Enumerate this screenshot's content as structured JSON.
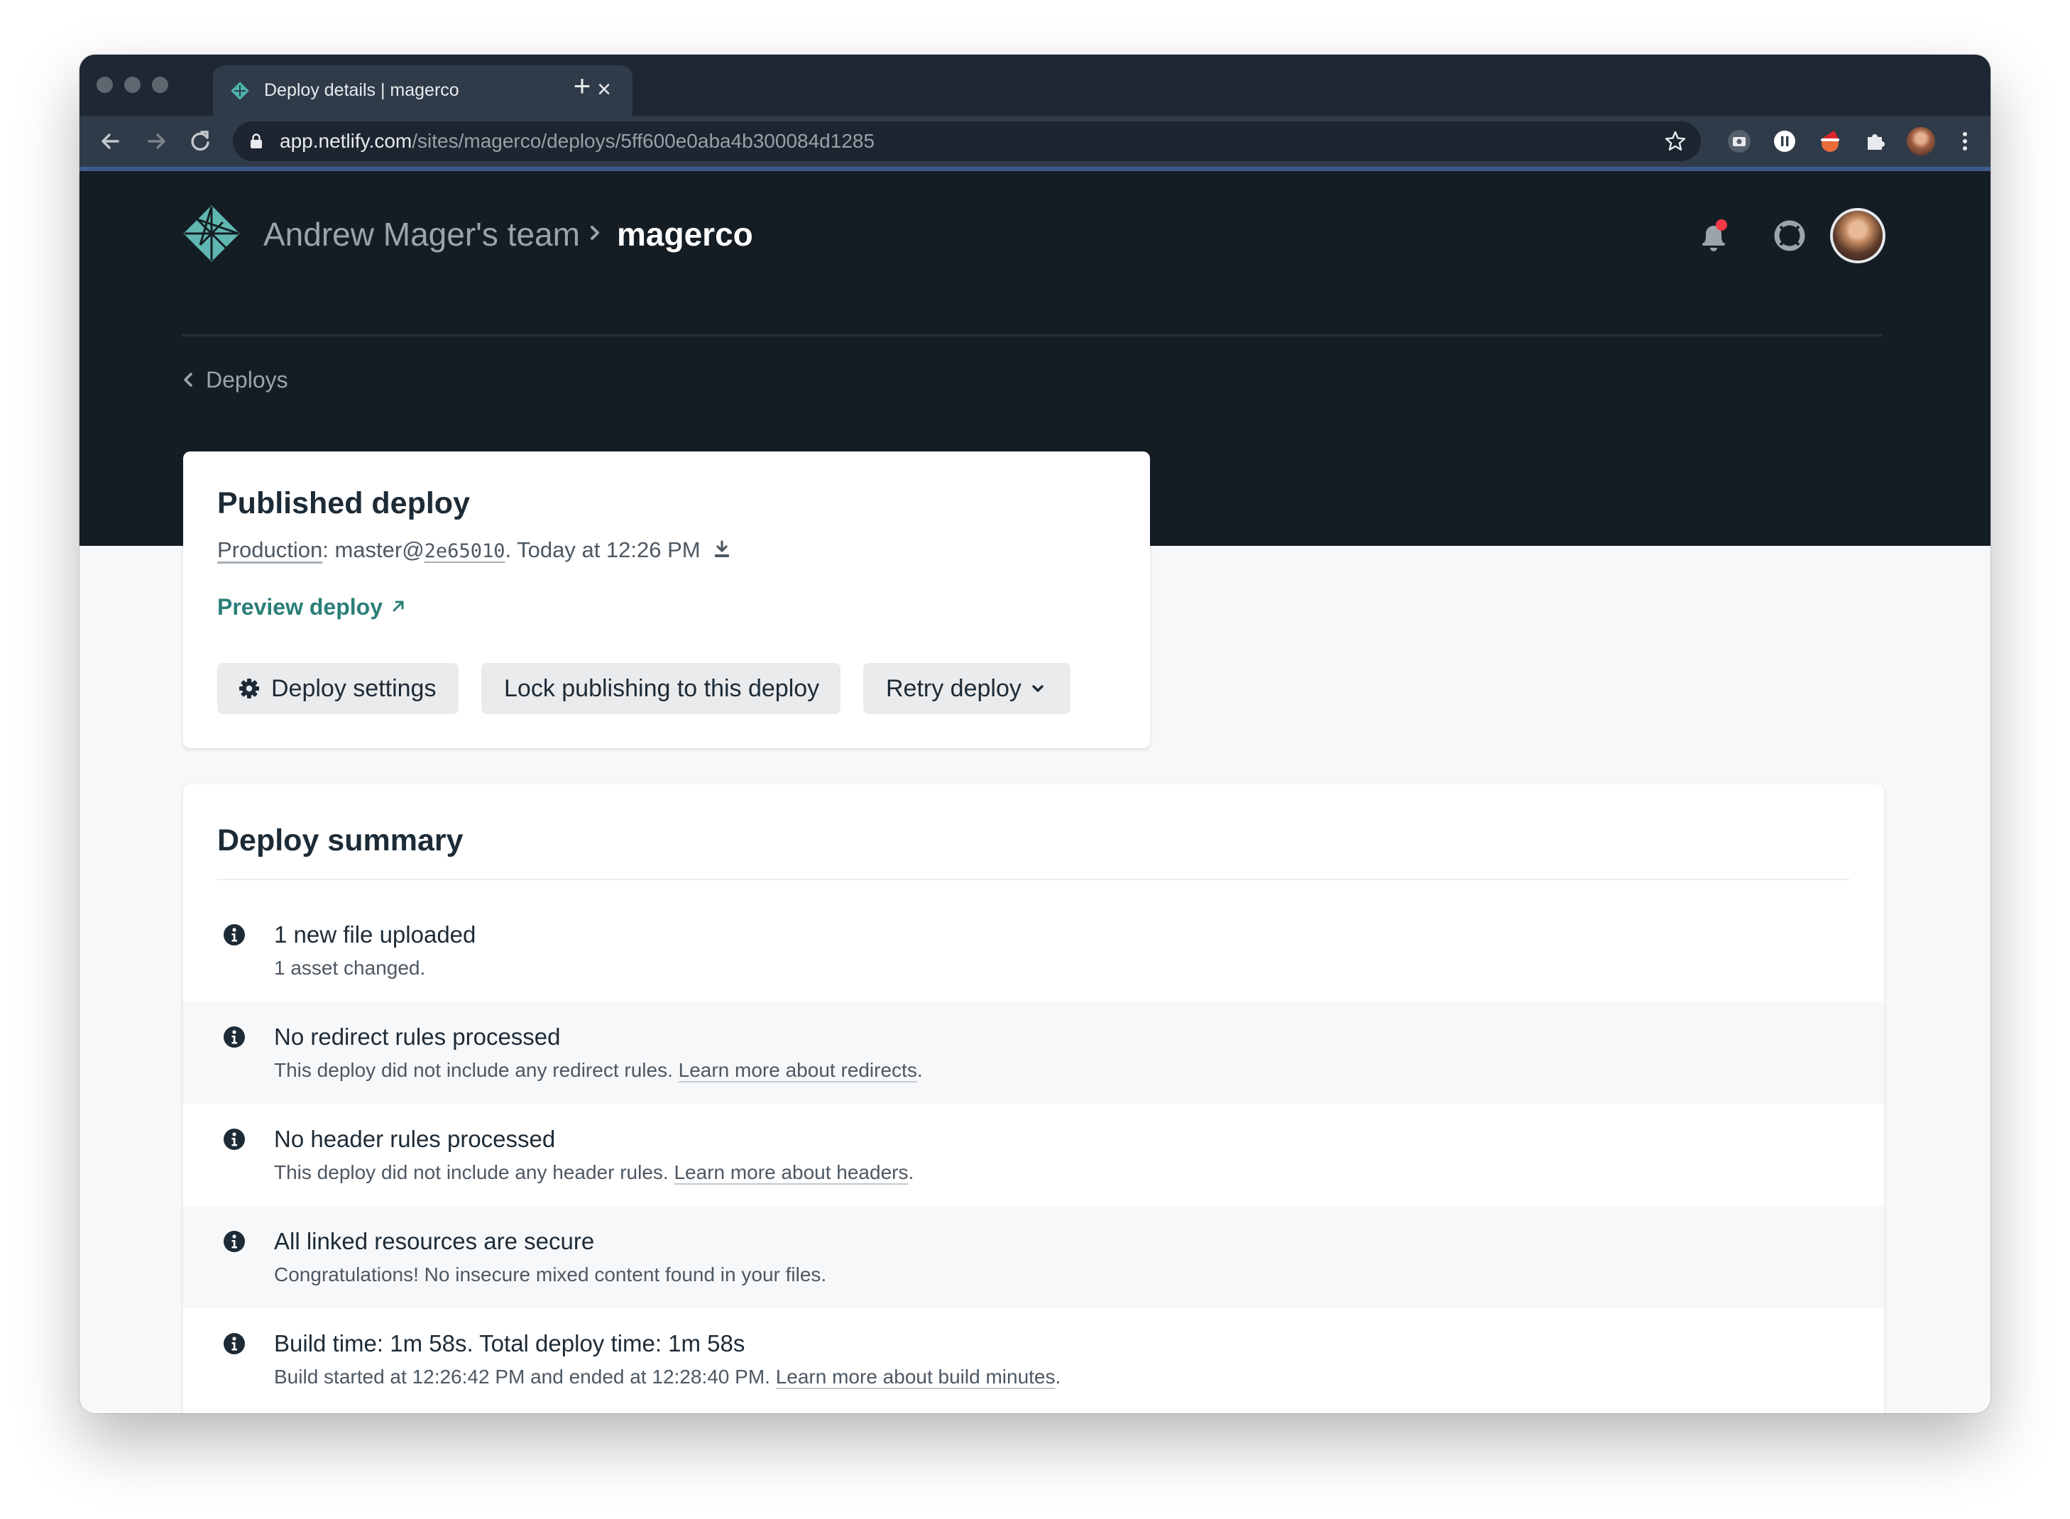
{
  "browser": {
    "tab_title": "Deploy details | magerco",
    "tab_close": "×",
    "new_tab": "+",
    "url_host": "app.netlify.com",
    "url_path": "/sites/magerco/deploys/5ff600e0aba4b300084d1285"
  },
  "header": {
    "team": "Andrew Mager's team",
    "site": "magerco"
  },
  "nav": {
    "back_label": "Deploys"
  },
  "deploy": {
    "title": "Published deploy",
    "context": "Production",
    "sep": ": ",
    "branch": "master@",
    "commit": "2e65010",
    "time": ". Today at 12:26 PM",
    "preview_label": "Preview deploy",
    "buttons": {
      "settings": "Deploy settings",
      "lock": "Lock publishing to this deploy",
      "retry": "Retry deploy"
    }
  },
  "summary": {
    "title": "Deploy summary",
    "items": [
      {
        "title": "1 new file uploaded",
        "desc": "1 asset changed.",
        "link": "",
        "end": ""
      },
      {
        "title": "No redirect rules processed",
        "desc": "This deploy did not include any redirect rules. ",
        "link": "Learn more about redirects",
        "end": "."
      },
      {
        "title": "No header rules processed",
        "desc": "This deploy did not include any header rules. ",
        "link": "Learn more about headers",
        "end": "."
      },
      {
        "title": "All linked resources are secure",
        "desc": "Congratulations! No insecure mixed content found in your files.",
        "link": "",
        "end": ""
      },
      {
        "title": "Build time: 1m 58s. Total deploy time: 1m 58s",
        "desc": "Build started at 12:26:42 PM and ended at 12:28:40 PM. ",
        "link": "Learn more about build minutes",
        "end": "."
      }
    ]
  },
  "colors": {
    "hero_bg": "#151d24",
    "accent_teal": "#2a7f78",
    "notification_dot": "#fa3946",
    "logo": "#5fb7b0"
  },
  "icons": [
    "netlify-logo-icon",
    "bell-icon",
    "help-icon",
    "chevron-left-icon",
    "download-icon",
    "external-arrow-icon",
    "gear-icon",
    "chevron-down-icon",
    "info-icon"
  ]
}
